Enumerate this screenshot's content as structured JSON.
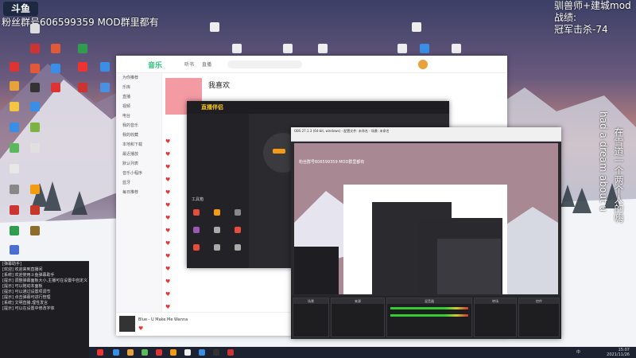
{
  "overlay": {
    "logo": "斗鱼",
    "fan_group": "粉丝群号606599359 MOD群里都有",
    "right_lines": [
      "驯兽师+建城mod",
      "战绩:",
      "冠军击杀-74"
    ],
    "vertical_1": "在雪道一个两个人的嗨",
    "vertical_2": "had a dream about u"
  },
  "music": {
    "tabs": [
      "音乐",
      "听书",
      "直播"
    ],
    "sidebar": [
      "为你推荐",
      "乐库",
      "直播",
      "视频",
      "电台",
      "我的音乐",
      "我的收藏",
      "本地和下载",
      "最近播放",
      "默认列表",
      "音乐小程序",
      "蓝牙",
      "每日推荐"
    ],
    "playlist_title": "我喜欢",
    "now_playing": "Blue - U Make Me Wanna"
  },
  "live": {
    "brand": "直播伴侣",
    "tools_label": "工具箱"
  },
  "obs": {
    "title": "OBS 27.1.3 (64-bit, windows) - 配置文件: 未命名 - 场景: 未命名",
    "inner_fan_group": "粉丝群号606599359 MOD群里都有",
    "dock_labels": [
      "场景",
      "来源",
      "混音器",
      "转场",
      "控件"
    ]
  },
  "chat": {
    "lines": [
      "[弹幕助手]",
      "",
      "[欢迎] 欢迎来到直播间",
      "",
      "",
      "",
      "",
      "[系统] 欢迎使用斗鱼弹幕助手",
      "[提示] 调整弹幕面板大小,主播可在设置中自定义",
      "[提示] 可以拖动本面板",
      "[提示] 可以通过设置项调节",
      "[提示] 点击弹幕可进行管理",
      "[系统] 文明直播,理性发言",
      "[提示] 可以在设置中修改字体"
    ]
  },
  "taskbar": {
    "time": "15:07",
    "date": "2021/11/26",
    "lang": "中"
  }
}
